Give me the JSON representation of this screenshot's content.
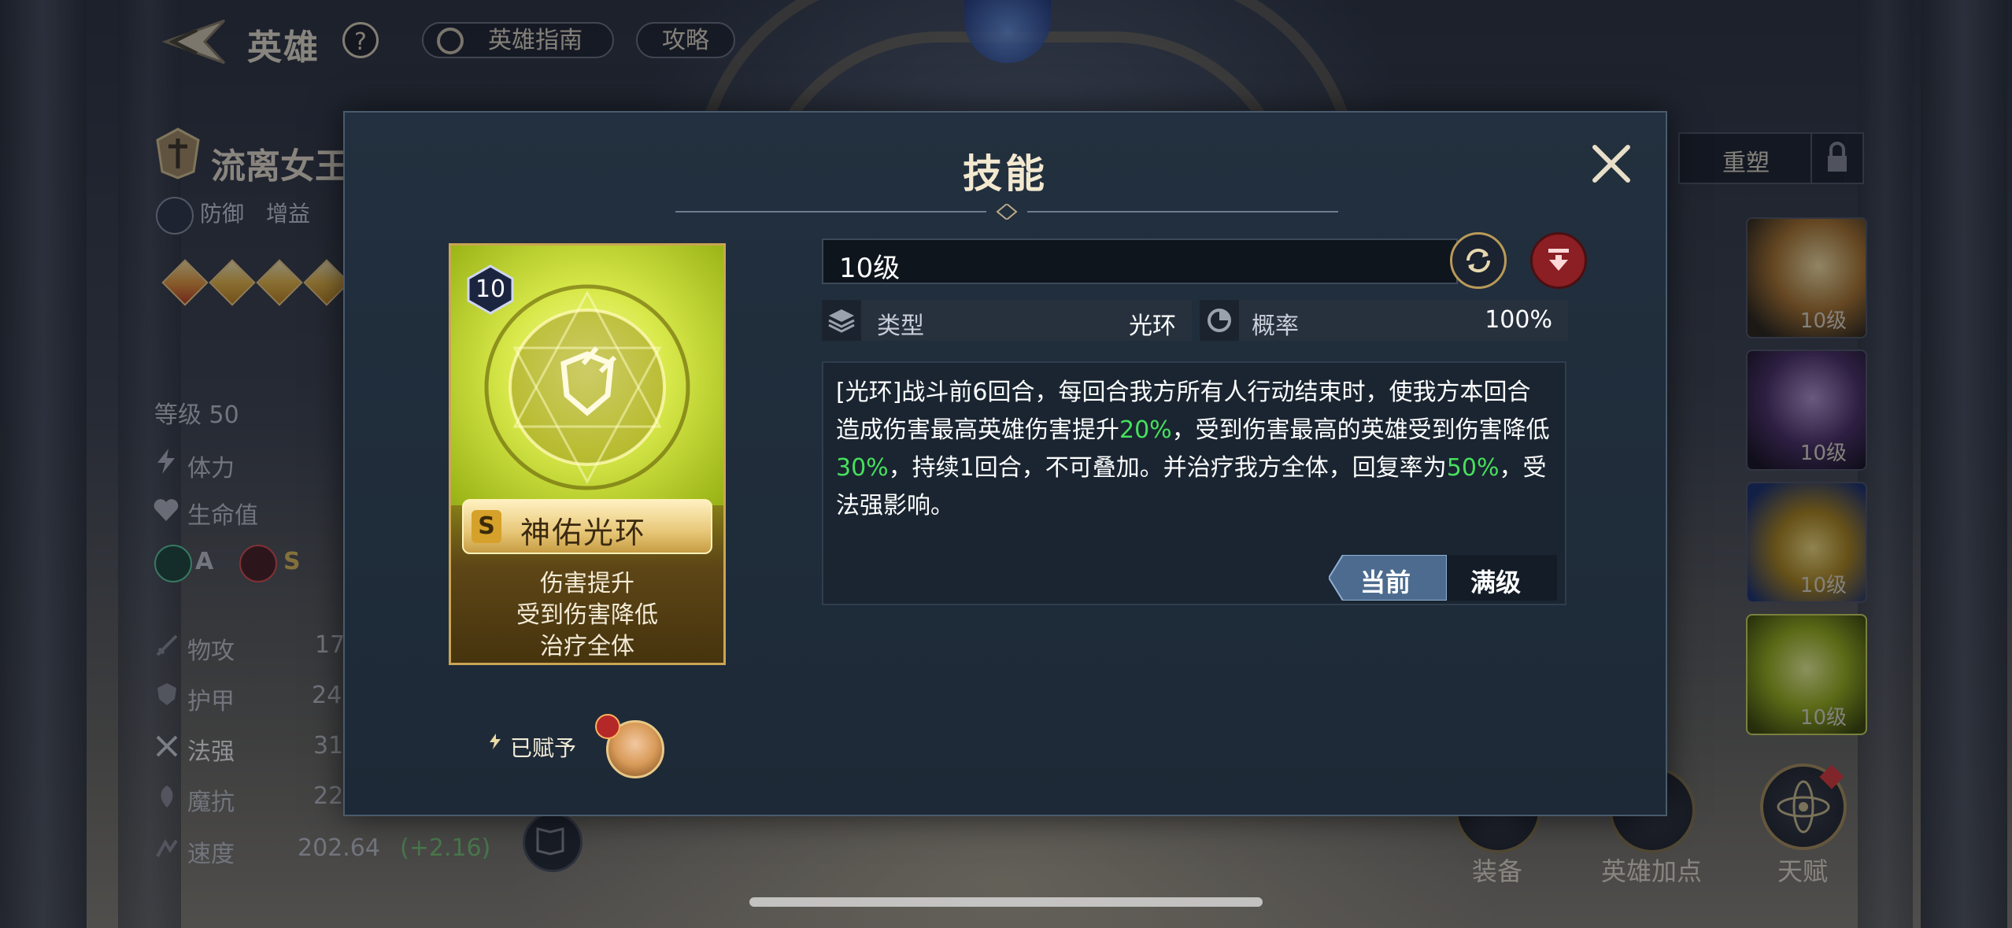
{
  "header": {
    "title": "英雄",
    "help": "?",
    "guide_label": "英雄指南",
    "strategy_label": "攻略"
  },
  "hero": {
    "name": "流离女王",
    "tags": [
      "防御",
      "增益"
    ],
    "level_label": "等级 50",
    "stats_top": [
      {
        "label": "体力"
      },
      {
        "label": "生命值"
      }
    ],
    "badges": [
      "A",
      "S"
    ],
    "stats": [
      {
        "label": "物攻",
        "value": "17"
      },
      {
        "label": "护甲",
        "value": "24"
      },
      {
        "label": "法强",
        "value": "31"
      },
      {
        "label": "魔抗",
        "value": "22"
      },
      {
        "label": "速度",
        "value": "202.64",
        "bonus": "(+2.16)"
      }
    ]
  },
  "right_panel": {
    "reshape_label": "重塑",
    "skill_levels": [
      "10级",
      "10级",
      "10级",
      "10级"
    ],
    "bottom_buttons": [
      {
        "label": "装备"
      },
      {
        "label": "英雄加点"
      },
      {
        "label": "天赋"
      }
    ]
  },
  "modal": {
    "title": "技能",
    "card": {
      "level": "10",
      "grade": "S",
      "name": "神佑光环",
      "effects": [
        "伤害提升",
        "受到伤害降低",
        "治疗全体"
      ]
    },
    "assigned_label": "已赋予",
    "level_value": "10级",
    "type_label": "类型",
    "type_value": "光环",
    "chance_label": "概率",
    "chance_value": "100%",
    "description": {
      "p1": "[光环]战斗前6回合，每回合我方所有人行动结束时，使我方本回合造成伤害最高英雄伤害提升",
      "v1": "20%",
      "p2": "，受到伤害最高的英雄受到伤害降低",
      "v2": "30%",
      "p3": "，持续1回合，不可叠加。并治疗我方全体，回复率为",
      "v3": "50%",
      "p4": "，受法强影响。"
    },
    "tab_current": "当前",
    "tab_max": "满级"
  },
  "colors": {
    "accent_gold": "#caa553",
    "value_green": "#46e05c",
    "danger_red": "#d8333a"
  }
}
